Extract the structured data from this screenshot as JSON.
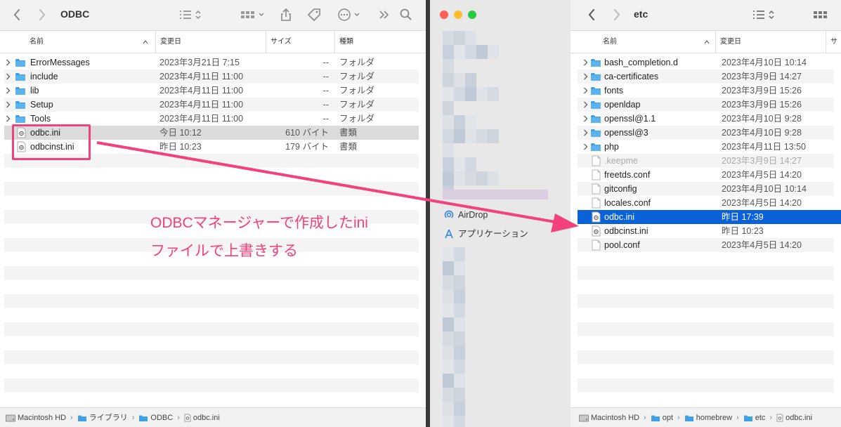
{
  "left": {
    "title": "ODBC",
    "columns": {
      "name": "名前",
      "date": "変更日",
      "size": "サイズ",
      "kind": "種類"
    },
    "rows": [
      {
        "name": "ErrorMessages",
        "date": "2023年3月21日 7:15",
        "size": "--",
        "kind": "フォルダ",
        "type": "folder"
      },
      {
        "name": "include",
        "date": "2023年4月11日 11:00",
        "size": "--",
        "kind": "フォルダ",
        "type": "folder"
      },
      {
        "name": "lib",
        "date": "2023年4月11日 11:00",
        "size": "--",
        "kind": "フォルダ",
        "type": "folder"
      },
      {
        "name": "Setup",
        "date": "2023年4月11日 11:00",
        "size": "--",
        "kind": "フォルダ",
        "type": "folder"
      },
      {
        "name": "Tools",
        "date": "2023年4月11日 11:00",
        "size": "--",
        "kind": "フォルダ",
        "type": "folder"
      },
      {
        "name": "odbc.ini",
        "date": "今日 10:12",
        "size": "610 バイト",
        "kind": "書類",
        "type": "file",
        "highlight": "gray"
      },
      {
        "name": "odbcinst.ini",
        "date": "昨日 10:23",
        "size": "179 バイト",
        "kind": "書類",
        "type": "file"
      }
    ],
    "path": [
      "Macintosh HD",
      "ライブラリ",
      "ODBC",
      "odbc.ini"
    ]
  },
  "sidebar": {
    "items": [
      {
        "label": "AirDrop",
        "icon": "airdrop-icon"
      },
      {
        "label": "アプリケーション",
        "icon": "applications-icon"
      }
    ]
  },
  "right": {
    "title": "etc",
    "columns": {
      "name": "名前",
      "date": "変更日",
      "size": "サ"
    },
    "rows": [
      {
        "name": "bash_completion.d",
        "date": "2023年4月10日 10:14",
        "type": "folder"
      },
      {
        "name": "ca-certificates",
        "date": "2023年3月9日 14:27",
        "type": "folder"
      },
      {
        "name": "fonts",
        "date": "2023年3月9日 15:26",
        "type": "folder"
      },
      {
        "name": "openldap",
        "date": "2023年3月9日 15:26",
        "type": "folder"
      },
      {
        "name": "openssl@1.1",
        "date": "2023年4月10日 9:28",
        "type": "folder"
      },
      {
        "name": "openssl@3",
        "date": "2023年4月10日 9:28",
        "type": "folder"
      },
      {
        "name": "php",
        "date": "2023年4月11日 13:50",
        "type": "folder"
      },
      {
        "name": ".keepme",
        "date": "2023年3月9日 14:27",
        "type": "doc",
        "dim": true
      },
      {
        "name": "freetds.conf",
        "date": "2023年4月5日 14:20",
        "type": "doc"
      },
      {
        "name": "gitconfig",
        "date": "2023年4月10日 10:14",
        "type": "doc"
      },
      {
        "name": "locales.conf",
        "date": "2023年4月5日 14:20",
        "type": "doc"
      },
      {
        "name": "odbc.ini",
        "date": "昨日 17:39",
        "type": "file",
        "highlight": "blue"
      },
      {
        "name": "odbcinst.ini",
        "date": "昨日 10:23",
        "type": "file"
      },
      {
        "name": "pool.conf",
        "date": "2023年4月5日 14:20",
        "type": "doc"
      }
    ],
    "path": [
      "Macintosh HD",
      "opt",
      "homebrew",
      "etc",
      "odbc.ini"
    ]
  },
  "annotation": {
    "line1": "ODBCマネージャーで作成したini",
    "line2": "ファイルで上書きする"
  },
  "colors": {
    "accent": "#f2417b",
    "selection": "#0b61d8",
    "folder": "#3fa0e6"
  }
}
